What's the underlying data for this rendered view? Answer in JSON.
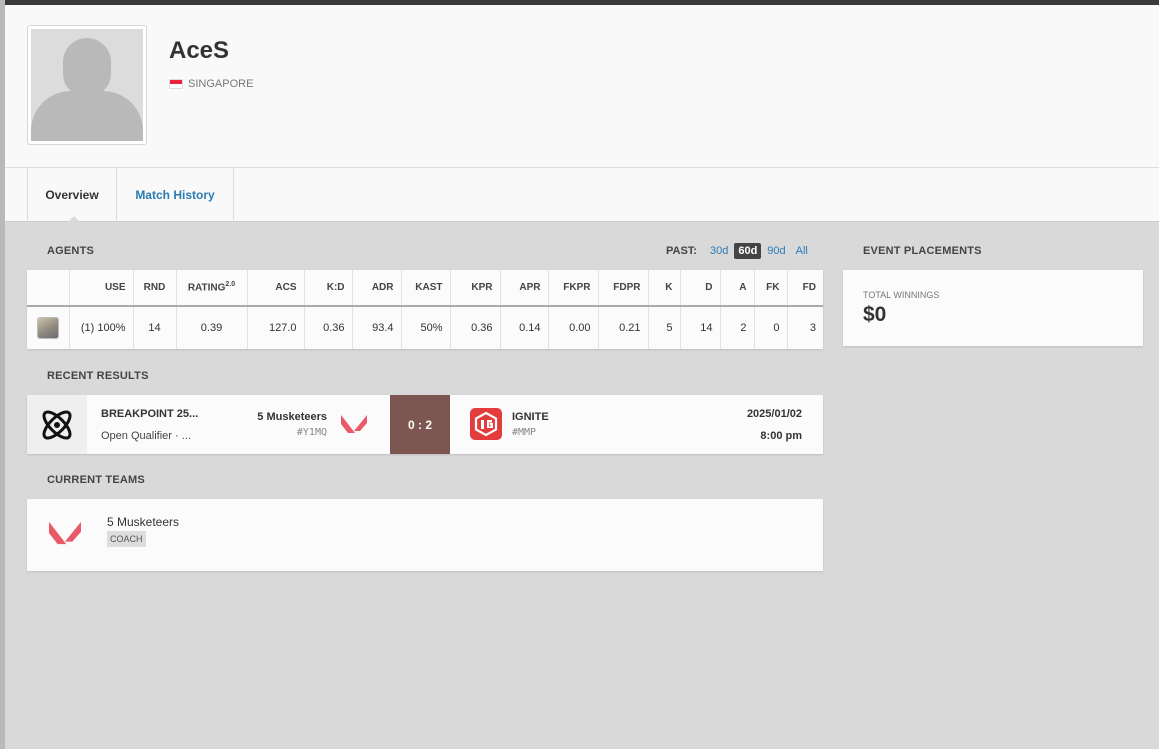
{
  "player": {
    "name": "AceS",
    "country": "SINGAPORE"
  },
  "tabs": [
    {
      "label": "Overview"
    },
    {
      "label": "Match History"
    }
  ],
  "agents": {
    "section_title": "AGENTS",
    "past_label": "PAST:",
    "past_options": [
      "30d",
      "60d",
      "90d",
      "All"
    ],
    "past_selected": "60d",
    "columns": [
      "USE",
      "RND",
      "RATING",
      "ACS",
      "K:D",
      "ADR",
      "KAST",
      "KPR",
      "APR",
      "FKPR",
      "FDPR",
      "K",
      "D",
      "A",
      "FK",
      "FD"
    ],
    "rating_version": "2.0",
    "rows": [
      {
        "use": "(1) 100%",
        "rnd": "14",
        "rating": "0.39",
        "acs": "127.0",
        "kd": "0.36",
        "adr": "93.4",
        "kast": "50%",
        "kpr": "0.36",
        "apr": "0.14",
        "fkpr": "0.00",
        "fdpr": "0.21",
        "k": "5",
        "d": "14",
        "a": "2",
        "fk": "0",
        "fd": "3"
      }
    ]
  },
  "event_placements": {
    "section_title": "EVENT PLACEMENTS",
    "total_winnings_label": "TOTAL WINNINGS",
    "total_winnings": "$0"
  },
  "recent_results": {
    "section_title": "RECENT RESULTS",
    "matches": [
      {
        "event": "BREAKPOINT 25...",
        "stage": "Open Qualifier · ...",
        "team1": "5 Musketeers",
        "team1_tag": "#Y1MQ",
        "score": "0 : 2",
        "team2": "IGNITE",
        "team2_tag": "#MMP",
        "date": "2025/01/02",
        "time": "8:00 pm"
      }
    ]
  },
  "current_teams": {
    "section_title": "CURRENT TEAMS",
    "teams": [
      {
        "name": "5 Musketeers",
        "role": "COACH"
      }
    ]
  },
  "colors": {
    "link": "#2b7bb3",
    "score_bg": "#7d5651",
    "valorant_red": "#e85a68",
    "ignite_red": "#e23c3c"
  }
}
